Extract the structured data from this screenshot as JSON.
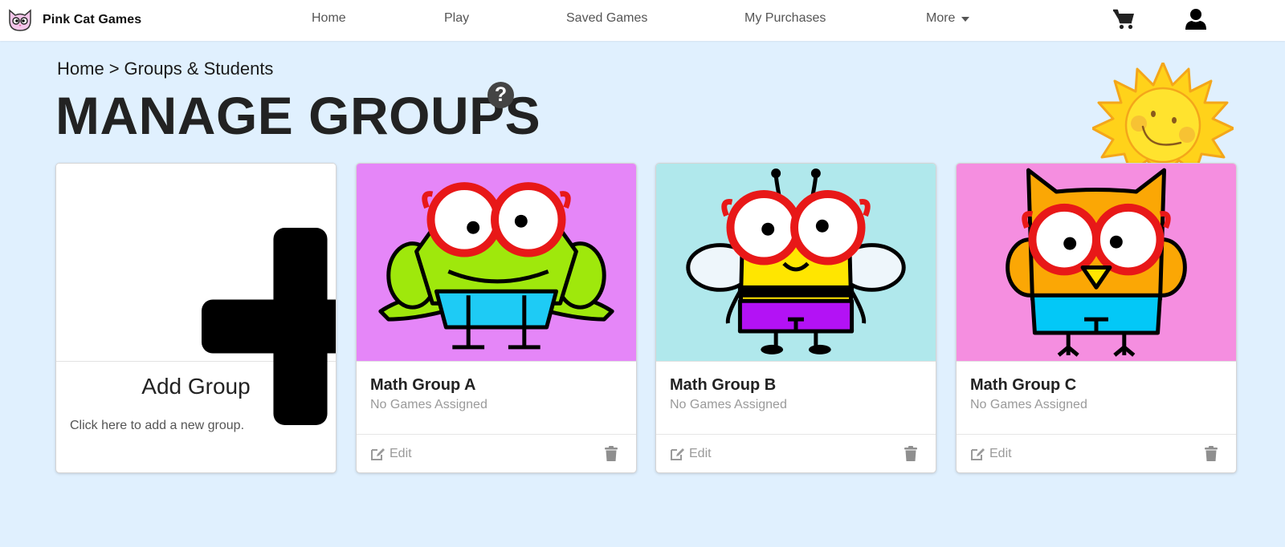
{
  "navbar": {
    "brand_name": "Pink Cat Games",
    "brand_icon": "pink-cat-logo",
    "links": [
      {
        "label": "Home"
      },
      {
        "label": "Play"
      },
      {
        "label": "Saved Games"
      },
      {
        "label": "My Purchases"
      },
      {
        "label": "More",
        "icon": "caret-down-icon"
      }
    ],
    "cart_icon": "shopping-cart-icon",
    "user_icon": "user-icon"
  },
  "breadcrumb": {
    "items": [
      "Home",
      "Groups & Students"
    ],
    "separator": ">"
  },
  "page": {
    "title": "MANAGE GROUPS",
    "help_glyph": "?",
    "decoration": "smiling-sun"
  },
  "add_card": {
    "title": "Add Group",
    "description": "Click here to add a new group.",
    "icon": "plus-icon"
  },
  "groups": [
    {
      "name": "Math Group A",
      "status": "No Games Assigned",
      "avatar": "frog-with-glasses",
      "bg_color": "#e586f8",
      "edit_label": "Edit"
    },
    {
      "name": "Math Group B",
      "status": "No Games Assigned",
      "avatar": "bee-with-glasses",
      "bg_color": "#b0e8ec",
      "edit_label": "Edit"
    },
    {
      "name": "Math Group C",
      "status": "No Games Assigned",
      "avatar": "owl-with-glasses",
      "bg_color": "#f58ee0",
      "edit_label": "Edit"
    }
  ],
  "colors": {
    "page_bg": "#e0f0fe",
    "muted_text": "#9a9a9a",
    "title_text": "#222222"
  }
}
